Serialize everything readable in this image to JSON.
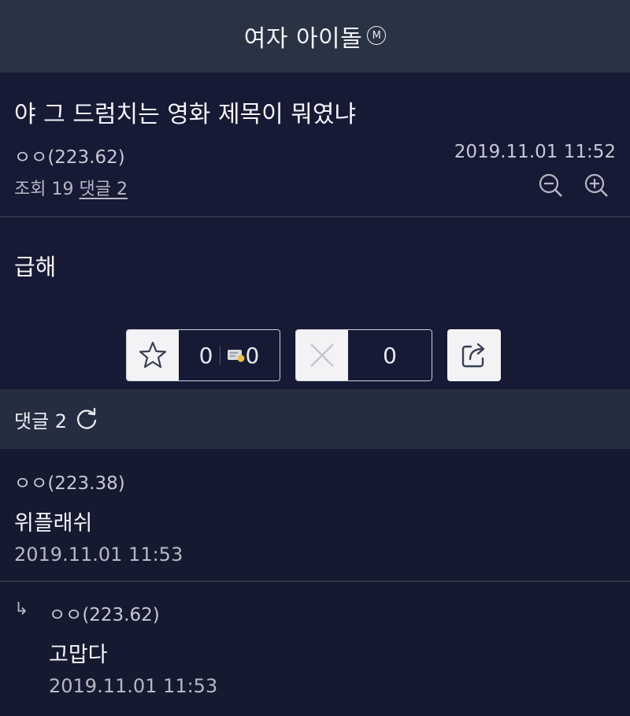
{
  "header": {
    "title": "여자 아이돌",
    "badge": "M"
  },
  "post": {
    "title": "야 그 드럼치는 영화 제목이 뭐였냐",
    "author": "ㅇㅇ(223.62)",
    "date": "2019.11.01 11:52",
    "views_label": "조회 19",
    "comments_link": "댓글 2",
    "body": "급해"
  },
  "votes": {
    "recommend_count": "0",
    "fix_count": "0",
    "downvote_count": "0"
  },
  "comments_section": {
    "label": "댓글 2"
  },
  "comments": [
    {
      "author": "ㅇㅇ(223.38)",
      "text": "위플래쉬",
      "date": "2019.11.01 11:53"
    },
    {
      "reply_marker": "↳",
      "author": "ㅇㅇ(223.62)",
      "text": "고맙다",
      "date": "2019.11.01 11:53"
    }
  ],
  "colors": {
    "background": "#161a30",
    "header_bg": "#2a3344",
    "button_bg": "#f3f3f5"
  }
}
